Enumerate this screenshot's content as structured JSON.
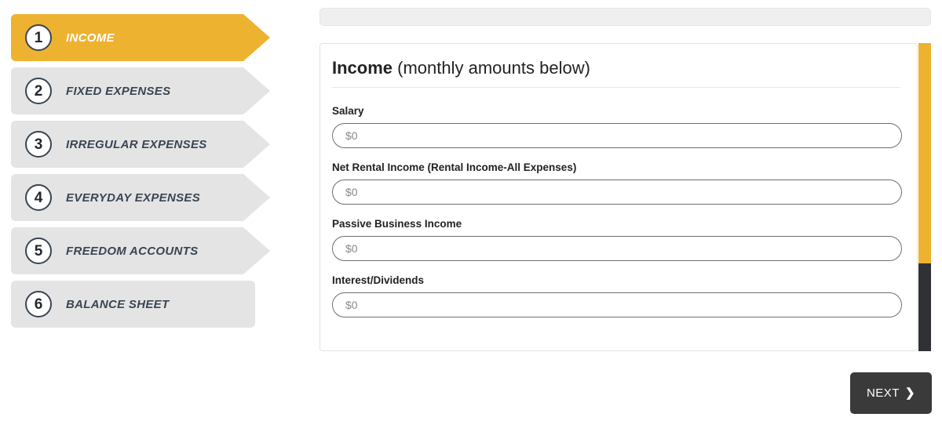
{
  "accent_color": "#EDB22F",
  "sidebar": {
    "steps": [
      {
        "number": "1",
        "label": "INCOME",
        "active": true,
        "arrow": true
      },
      {
        "number": "2",
        "label": "FIXED EXPENSES",
        "active": false,
        "arrow": true
      },
      {
        "number": "3",
        "label": "IRREGULAR EXPENSES",
        "active": false,
        "arrow": true
      },
      {
        "number": "4",
        "label": "EVERYDAY EXPENSES",
        "active": false,
        "arrow": true
      },
      {
        "number": "5",
        "label": "FREEDOM ACCOUNTS",
        "active": false,
        "arrow": true
      },
      {
        "number": "6",
        "label": "BALANCE SHEET",
        "active": false,
        "arrow": false
      }
    ]
  },
  "main": {
    "title_bold": "Income",
    "title_rest": " (monthly amounts below)",
    "fields": [
      {
        "label": "Salary",
        "value": "",
        "placeholder": "$0"
      },
      {
        "label": "Net Rental Income (Rental Income-All Expenses)",
        "value": "",
        "placeholder": "$0"
      },
      {
        "label": "Passive Business Income",
        "value": "",
        "placeholder": "$0"
      },
      {
        "label": "Interest/Dividends",
        "value": "",
        "placeholder": "$0"
      }
    ]
  },
  "footer": {
    "next_label": "NEXT",
    "next_chevron": "❯"
  },
  "scrollbar": {
    "thumb_color": "#EDB22F",
    "track_color": "#2F3134"
  }
}
